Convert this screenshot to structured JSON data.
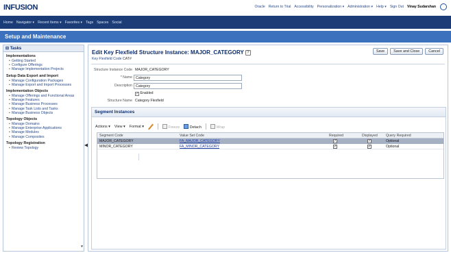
{
  "header": {
    "logo": "INFUSION",
    "links": [
      "Oracle",
      "Return to Trial",
      "Accessibility",
      "Personalization ▾",
      "Administration ▾",
      "Help ▾",
      "Sign Out"
    ],
    "user": "Vinay Sudarshan"
  },
  "navbar": {
    "items": [
      "Home",
      "Navigator ▾",
      "Recent Items ▾",
      "Favorites ▾",
      "Tags",
      "Spaces",
      "Social"
    ]
  },
  "page_title": "Setup and Maintenance",
  "tasks_panel": {
    "header": "Tasks",
    "sections": [
      {
        "title": "Implementations",
        "links": [
          "Getting Started",
          "Configure Offerings",
          "Manage Implementation Projects"
        ]
      },
      {
        "title": "Setup Data Export and Import",
        "links": [
          "Manage Configuration Packages",
          "Manage Export and Import Processes"
        ]
      },
      {
        "title": "Implementation Objects",
        "links": [
          "Manage Offerings and Functional Areas",
          "Manage Features",
          "Manage Business Processes",
          "Manage Task Lists and Tasks",
          "Manage Business Objects"
        ]
      },
      {
        "title": "Topology Objects",
        "links": [
          "Manage Domains",
          "Manage Enterprise Applications",
          "Manage Modules",
          "Manage Composites"
        ]
      },
      {
        "title": "Topology Registration",
        "links": [
          "Review Topology"
        ]
      }
    ]
  },
  "editor": {
    "title": "Edit Key Flexfield Structure Instance: MAJOR_CATEGORY",
    "flexfield_code_label": "Key Flexfield Code",
    "flexfield_code": "CAT#",
    "buttons": {
      "save": "Save",
      "save_close": "Save and Close",
      "cancel": "Cancel"
    },
    "form": {
      "instance_code_label": "Structure Instance Code",
      "instance_code": "MAJOR_CATEGORY",
      "name_label": "* Name",
      "name_value": "Category",
      "description_label": "Description",
      "description_value": "Category",
      "enabled_label": "Enabled",
      "enabled": true,
      "structure_name_label": "Structure Name",
      "structure_name": "Category Flexfield"
    }
  },
  "segments": {
    "title": "Segment Instances",
    "toolbar": {
      "actions": "Actions ▾",
      "view": "View ▾",
      "format": "Format ▾",
      "freeze": "Freeze",
      "detach": "Detach",
      "wrap": "Wrap"
    },
    "columns": {
      "segment_code": "Segment Code",
      "value_set_code": "Value Set Code",
      "required": "Required",
      "displayed": "Displayed",
      "query_required": "Query Required"
    },
    "rows": [
      {
        "segment_code": "MAJOR_CATEGORY",
        "value_set_code": "FA_MAJOR_CATEGORY",
        "required": true,
        "displayed": true,
        "query_required": "Optional",
        "selected": true
      },
      {
        "segment_code": "MINOR_CATEGORY",
        "value_set_code": "FA_MINOR_CATEGORY",
        "required": true,
        "displayed": true,
        "query_required": "Optional",
        "selected": false
      }
    ]
  },
  "colors": {
    "navbar": "#1c3c78",
    "page_title_bar": "#3c71bd",
    "selected_row": "#a6b0c3"
  }
}
